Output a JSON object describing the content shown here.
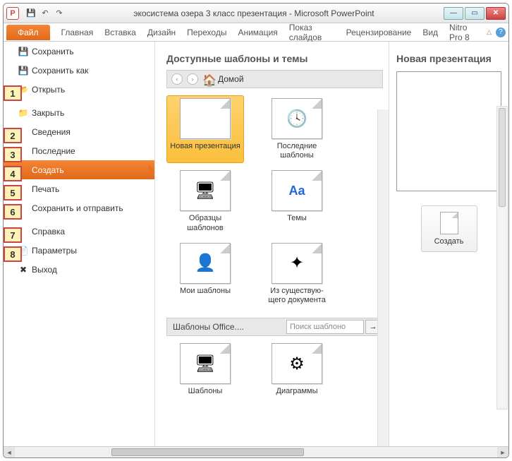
{
  "titlebar": {
    "app_icon_letter": "P",
    "doc_title": "экосистема озера 3 класс презентация  - Microsoft PowerPoint"
  },
  "ribbon": {
    "file": "Файл",
    "tabs": [
      "Главная",
      "Вставка",
      "Дизайн",
      "Переходы",
      "Анимация",
      "Показ слайдов",
      "Рецензирование",
      "Вид",
      "Nitro Pro 8"
    ]
  },
  "sidebar": {
    "items": [
      {
        "label": "Сохранить",
        "icon": "💾"
      },
      {
        "label": "Сохранить как",
        "icon": "💾"
      },
      {
        "label": "Открыть",
        "icon": "📂",
        "callout": "1"
      },
      {
        "label": "Закрыть",
        "icon": "📁"
      },
      {
        "label": "Сведения",
        "callout": "2"
      },
      {
        "label": "Последние",
        "callout": "3"
      },
      {
        "label": "Создать",
        "callout": "4",
        "selected": true
      },
      {
        "label": "Печать",
        "callout": "5"
      },
      {
        "label": "Сохранить и отправить",
        "callout": "6"
      },
      {
        "label": "Справка",
        "callout": "7"
      },
      {
        "label": "Параметры",
        "icon": "📄",
        "callout": "8"
      },
      {
        "label": "Выход",
        "icon": "✖"
      }
    ]
  },
  "templates": {
    "section_title": "Доступные шаблоны и темы",
    "breadcrumb_home": "Домой",
    "items": [
      {
        "label": "Новая презентация",
        "selected": true
      },
      {
        "label": "Последние шаблоны",
        "badge": "🕓"
      },
      {
        "label": "Образцы шаблонов",
        "badge": "🖥"
      },
      {
        "label": "Темы",
        "badge": "Aa"
      },
      {
        "label": "Мои шаблоны",
        "badge": "👤"
      },
      {
        "label": "Из существую-щего документа",
        "badge": "✦"
      },
      {
        "label": "Шаблоны",
        "badge": "🖥"
      },
      {
        "label": "Диаграммы",
        "badge": "⚙"
      }
    ],
    "office_label": "Шаблоны Office....",
    "search_placeholder": "Поиск шаблоно"
  },
  "preview": {
    "title": "Новая презентация",
    "create": "Создать"
  }
}
